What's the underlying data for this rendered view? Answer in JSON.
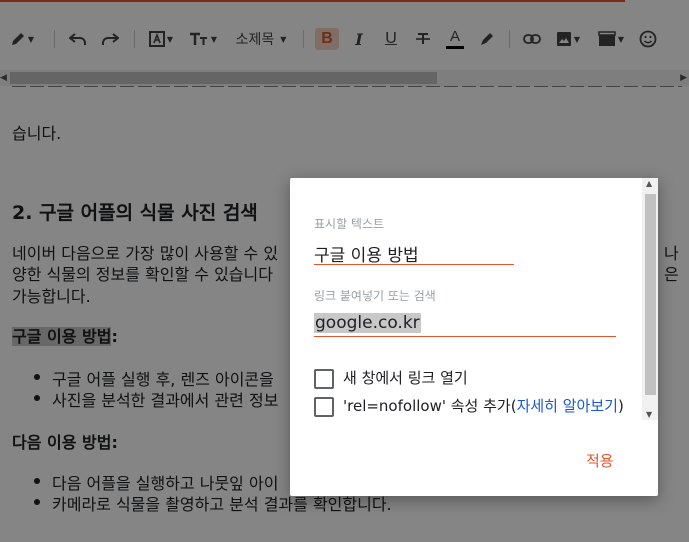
{
  "toolbar": {
    "font_size_label": "소제목",
    "bold_label": "B",
    "italic_label": "I",
    "underline_label": "U",
    "text_color_icon": "A",
    "icons": [
      "pencil-icon",
      "undo-icon",
      "redo-icon",
      "text-style-icon",
      "font-size-icon",
      "strikethrough-icon",
      "highlighter-icon",
      "link-icon",
      "image-icon",
      "video-icon",
      "emoji-icon"
    ]
  },
  "content": {
    "line_top": "습니다.",
    "heading": "2. 구글 어플의 식물 사진 검색",
    "para1_line1": "네이버 다음으로 가장 많이 사용할 수 있",
    "para1_line1_right": "나",
    "para1_line2": "양한 식물의 정보를 확인할 수 있습니다",
    "para1_line2_right": "은",
    "para1_line3": "가능합니다.",
    "google_title": "구글 이용 방법",
    "google_title_colon": ":",
    "google_items": [
      "구글 어플 실행 후, 렌즈 아이콘을",
      "사진을 분석한 결과에서 관련 정보"
    ],
    "daum_title": "다음 이용 방법:",
    "daum_items": [
      "다음 어플을 실행하고 나뭇잎 아이",
      "카메라로 식물을 촬영하고 분석 결과를 확인합니다."
    ]
  },
  "dialog": {
    "text_label": "표시할 텍스트",
    "text_value": "구글 이용 방법",
    "url_label": "링크 붙여넣기 또는 검색",
    "url_value": "google.co.kr",
    "checkbox_new_window": "새 창에서 링크 열기",
    "checkbox_nofollow": "'rel=nofollow' 속성 추가(",
    "learn_more": "자세히 알아보기",
    "checkbox_nofollow_end": ")",
    "apply_label": "적용"
  },
  "colors": {
    "accent": "#e8542c",
    "link": "#1a57d6",
    "overlay": "rgba(0,0,0,0.48)"
  }
}
